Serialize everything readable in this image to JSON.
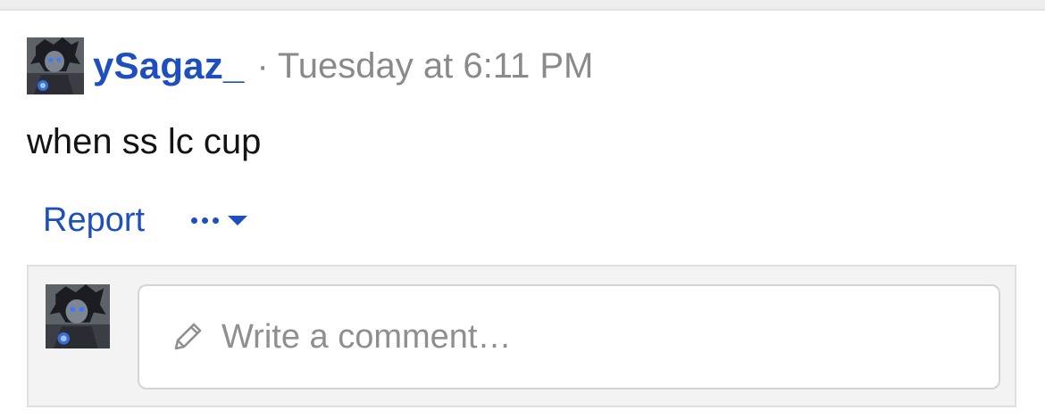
{
  "post": {
    "author": "ySagaz_",
    "separator": "·",
    "timestamp": "Tuesday at 6:11 PM",
    "body": "when ss lc cup"
  },
  "actions": {
    "report_label": "Report",
    "more_icon": "more-dots-icon"
  },
  "comment": {
    "placeholder": "Write a comment…",
    "icon": "pencil-icon"
  },
  "colors": {
    "link": "#1d4fbf",
    "muted": "#8a8a8a",
    "text": "#141414",
    "comment_bg": "#f3f3f3"
  }
}
